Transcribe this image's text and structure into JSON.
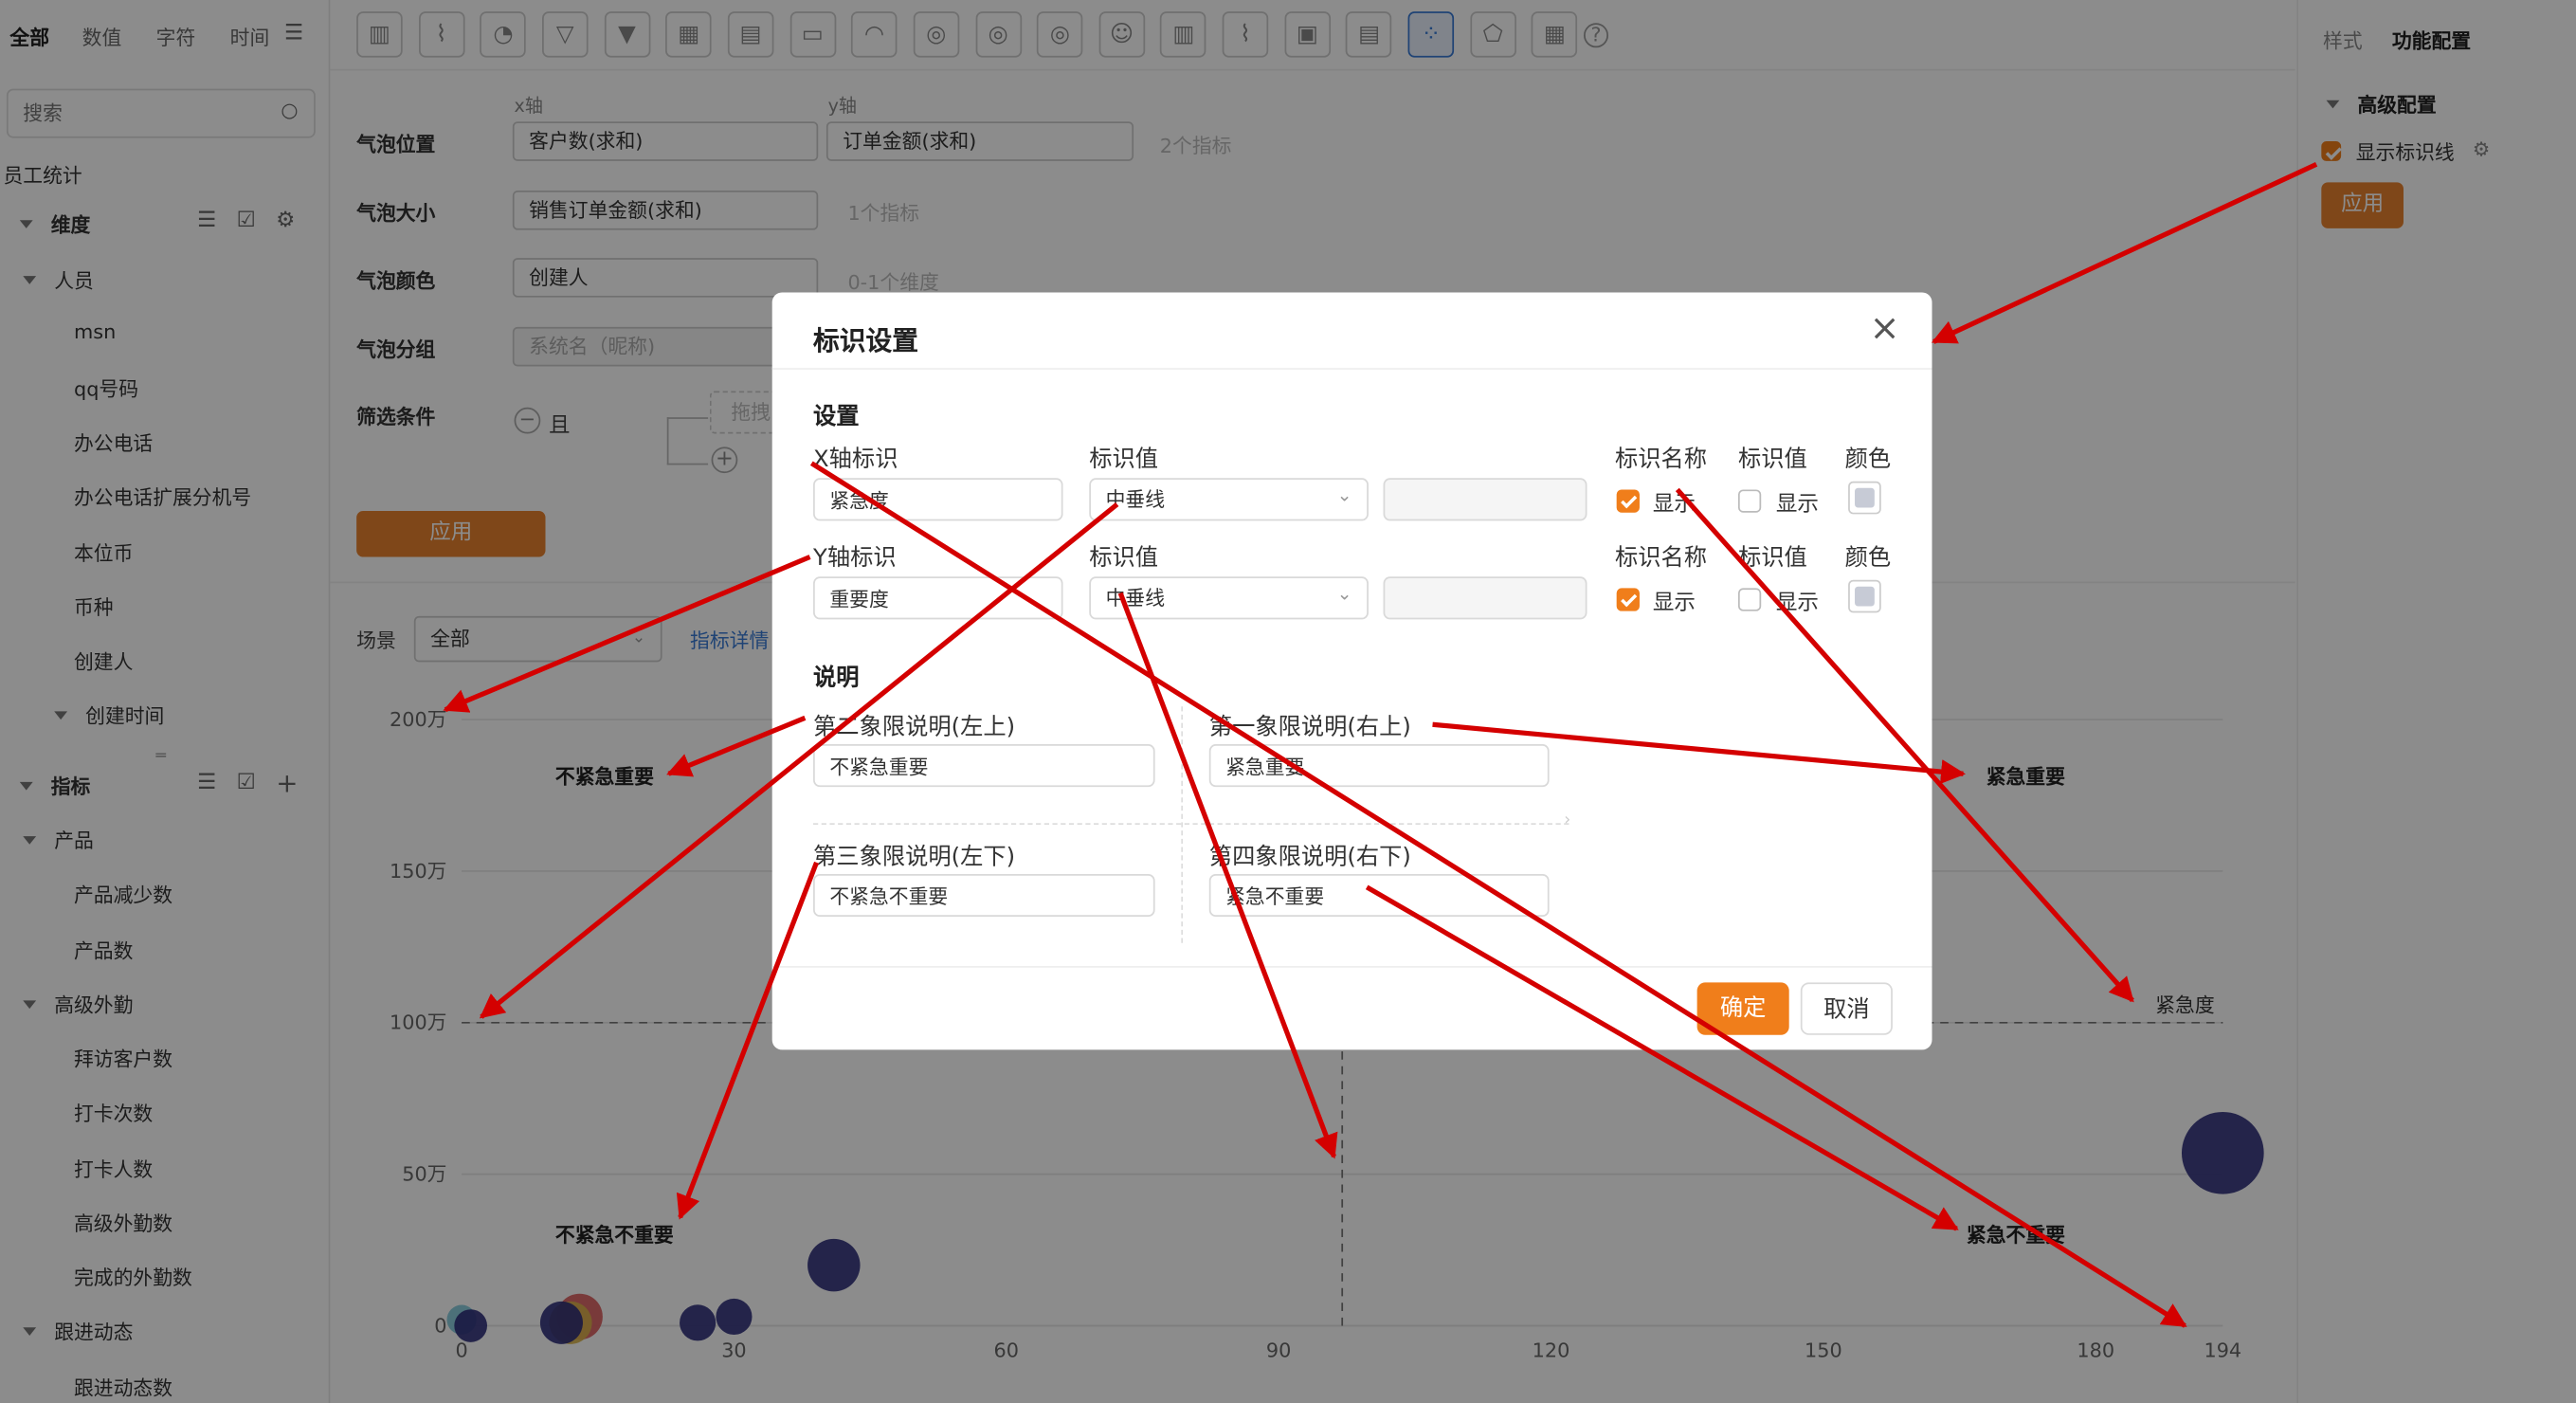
{
  "left_tabs": [
    "全部",
    "数值",
    "字符",
    "时间"
  ],
  "search_placeholder": "搜索",
  "dataset_name": "员工统计",
  "dimension_title": "维度",
  "group_person": "人员",
  "person_fields": [
    "msn",
    "qq号码",
    "办公电话",
    "办公电话扩展分机号",
    "本位币",
    "币种",
    "创建人"
  ],
  "created_time": "创建时间",
  "metric_title": "指标",
  "group_product": "产品",
  "product_fields": [
    "产品减少数",
    "产品数"
  ],
  "group_field": "高级外勤",
  "field_fields": [
    "拜访客户数",
    "打卡次数",
    "打卡人数",
    "高级外勤数",
    "完成的外勤数"
  ],
  "group_follow": "跟进动态",
  "follow_fields": [
    "跟进动态数"
  ],
  "form": {
    "x_axis_label": "x轴",
    "y_axis_label": "y轴",
    "position_label": "气泡位置",
    "x_value": "客户数(求和)",
    "y_value": "订单金额(求和)",
    "position_hint": "2个指标",
    "size_label": "气泡大小",
    "size_value": "销售订单金额(求和)",
    "size_hint": "1个指标",
    "color_label": "气泡颜色",
    "color_value": "创建人",
    "color_hint": "0-1个维度",
    "group_label": "气泡分组",
    "group_value": "系统名（昵称)",
    "filter_label": "筛选条件",
    "filter_and": "且",
    "drag_hint": "拖拽",
    "apply": "应用"
  },
  "scene_label": "场景",
  "scene_value": "全部",
  "metric_detail_link": "指标详情",
  "right": {
    "tab_style": "样式",
    "tab_function": "功能配置",
    "advanced": "高级配置",
    "show_marker_line": "显示标识线",
    "apply": "应用"
  },
  "chart_data": {
    "type": "scatter",
    "x_ticks": [
      "0",
      "30",
      "60",
      "90",
      "120",
      "150",
      "180",
      "194"
    ],
    "y_ticks": [
      "0",
      "50万",
      "100万",
      "150万",
      "200万"
    ],
    "xlim": [
      0,
      194
    ],
    "ylim": [
      0,
      200
    ],
    "x_marker_value": 97,
    "x_marker_name": "紧急度",
    "y_marker_value": 100,
    "quadrant_labels": {
      "top_left": "不紧急重要",
      "top_right": "紧急重要",
      "bottom_left": "不紧急不重要",
      "bottom_right": "紧急不重要"
    },
    "points": [
      {
        "x": 0,
        "y": 2,
        "r": 9,
        "color": "#7ec8d8"
      },
      {
        "x": 1,
        "y": 0,
        "r": 10,
        "color": "#2e2e7a"
      },
      {
        "x": 13,
        "y": 3,
        "r": 14,
        "color": "#d95b5b"
      },
      {
        "x": 12,
        "y": 1,
        "r": 13,
        "color": "#d9b44a"
      },
      {
        "x": 11,
        "y": 1,
        "r": 13,
        "color": "#2e2e7a"
      },
      {
        "x": 26,
        "y": 1,
        "r": 11,
        "color": "#2e2e7a"
      },
      {
        "x": 30,
        "y": 3,
        "r": 11,
        "color": "#2e2e7a"
      },
      {
        "x": 41,
        "y": 20,
        "r": 16,
        "color": "#2e2e7a"
      },
      {
        "x": 194,
        "y": 57,
        "r": 25,
        "color": "#2e2e7a"
      }
    ]
  },
  "modal": {
    "title": "标识设置",
    "section_settings": "设置",
    "x_marker_label": "X轴标识",
    "x_marker_value": "紧急度",
    "y_marker_label": "Y轴标识",
    "y_marker_value": "重要度",
    "marker_value_label": "标识值",
    "marker_value_option": "中垂线",
    "marker_name_label": "标识名称",
    "color_label": "颜色",
    "show": "显示",
    "section_desc": "说明",
    "q2_label": "第二象限说明(左上)",
    "q2_value": "不紧急重要",
    "q1_label": "第一象限说明(右上)",
    "q1_value": "紧急重要",
    "q3_label": "第三象限说明(左下)",
    "q3_value": "不紧急不重要",
    "q4_label": "第四象限说明(右下)",
    "q4_value": "紧急不重要",
    "ok": "确定",
    "cancel": "取消"
  },
  "colors": {
    "accent": "#f07e1b",
    "arrow": "#d40000",
    "bubble": "#2e2e7a"
  }
}
